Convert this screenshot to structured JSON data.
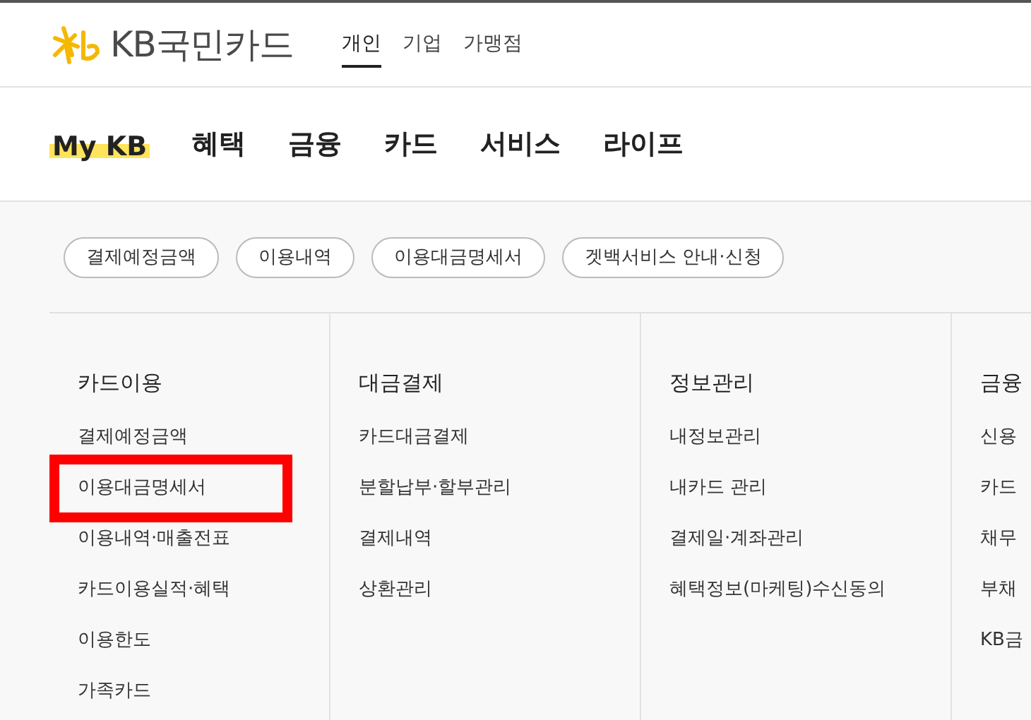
{
  "logo": {
    "brand": "KB",
    "name": "국민카드"
  },
  "segments": [
    {
      "label": "개인",
      "selected": true
    },
    {
      "label": "기업",
      "selected": false
    },
    {
      "label": "가맹점",
      "selected": false
    }
  ],
  "main_nav": [
    {
      "label": "My KB",
      "selected": true
    },
    {
      "label": "혜택",
      "selected": false
    },
    {
      "label": "금융",
      "selected": false
    },
    {
      "label": "카드",
      "selected": false
    },
    {
      "label": "서비스",
      "selected": false
    },
    {
      "label": "라이프",
      "selected": false
    }
  ],
  "quick_links": [
    "결제예정금액",
    "이용내역",
    "이용대금명세서",
    "겟백서비스 안내·신청"
  ],
  "menu_columns": [
    {
      "title": "카드이용",
      "items": [
        {
          "label": "결제예정금액",
          "highlighted": false
        },
        {
          "label": "이용대금명세서",
          "highlighted": true
        },
        {
          "label": "이용내역·매출전표",
          "highlighted": false
        },
        {
          "label": "카드이용실적·혜택",
          "highlighted": false
        },
        {
          "label": "이용한도",
          "highlighted": false
        },
        {
          "label": "가족카드",
          "highlighted": false
        }
      ]
    },
    {
      "title": "대금결제",
      "items": [
        {
          "label": "카드대금결제",
          "highlighted": false
        },
        {
          "label": "분할납부·할부관리",
          "highlighted": false
        },
        {
          "label": "결제내역",
          "highlighted": false
        },
        {
          "label": "상환관리",
          "highlighted": false
        }
      ]
    },
    {
      "title": "정보관리",
      "items": [
        {
          "label": "내정보관리",
          "highlighted": false
        },
        {
          "label": "내카드 관리",
          "highlighted": false
        },
        {
          "label": "결제일·계좌관리",
          "highlighted": false
        },
        {
          "label": "혜택정보(마케팅)수신동의",
          "highlighted": false
        }
      ]
    },
    {
      "title": "금융",
      "items": [
        {
          "label": "신용",
          "highlighted": false
        },
        {
          "label": "카드",
          "highlighted": false
        },
        {
          "label": "채무",
          "highlighted": false
        },
        {
          "label": "부채",
          "highlighted": false
        },
        {
          "label": "KB금",
          "highlighted": false
        }
      ]
    }
  ]
}
